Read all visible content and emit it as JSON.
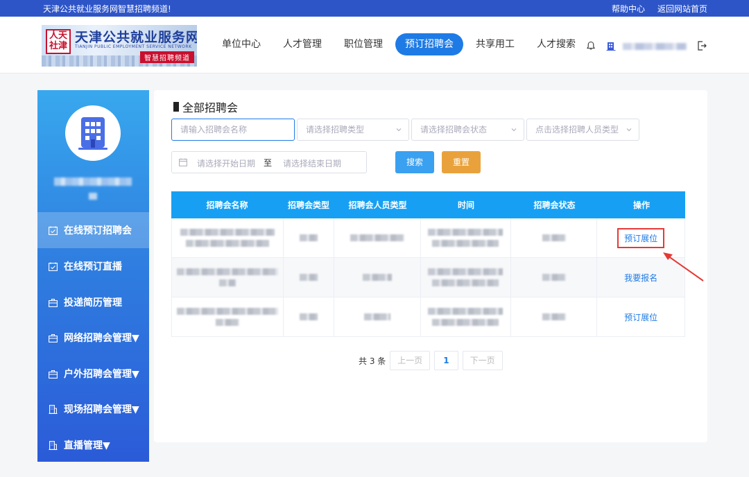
{
  "topbar": {
    "welcome": "天津公共就业服务网智慧招聘频道!",
    "links": [
      "帮助中心",
      "返回网站首页"
    ]
  },
  "logo": {
    "seal": "人天社津",
    "cn": "天津公共就业服务网",
    "en": "TIANJIN PUBLIC EMPLOYMENT SERVICE NETWORK",
    "sub": "智慧招聘频道"
  },
  "nav": {
    "items": [
      "单位中心",
      "人才管理",
      "职位管理",
      "预订招聘会",
      "共享用工",
      "人才搜索"
    ],
    "active_index": 3
  },
  "sidebar": {
    "items": [
      "在线预订招聘会",
      "在线预订直播",
      "投递简历管理",
      "网络招聘会管理▼",
      "户外招聘会管理▼",
      "现场招聘会管理▼",
      "直播管理▼"
    ],
    "active_index": 0
  },
  "panel": {
    "title": "全部招聘会",
    "filters": {
      "name_placeholder": "请输入招聘会名称",
      "type_placeholder": "请选择招聘类型",
      "status_placeholder": "请选择招聘会状态",
      "people_placeholder": "点击选择招聘人员类型"
    },
    "date": {
      "start_placeholder": "请选择开始日期",
      "separator": "至",
      "end_placeholder": "请选择结束日期"
    },
    "search_label": "搜索",
    "reset_label": "重置"
  },
  "table": {
    "columns": [
      "招聘会名称",
      "招聘会类型",
      "招聘会人员类型",
      "时间",
      "招聘会状态",
      "操作"
    ],
    "rows": [
      {
        "action": "预订展位"
      },
      {
        "action": "我要报名"
      },
      {
        "action": "预订展位"
      }
    ]
  },
  "pager": {
    "total": "共 3 条",
    "prev": "上一页",
    "current": "1",
    "next": "下一页"
  },
  "colors": {
    "topbar": "#2e55c7",
    "accent": "#1e7be6",
    "table_header": "#17a0f3",
    "reset": "#e9a23b",
    "highlight": "#e53935"
  }
}
